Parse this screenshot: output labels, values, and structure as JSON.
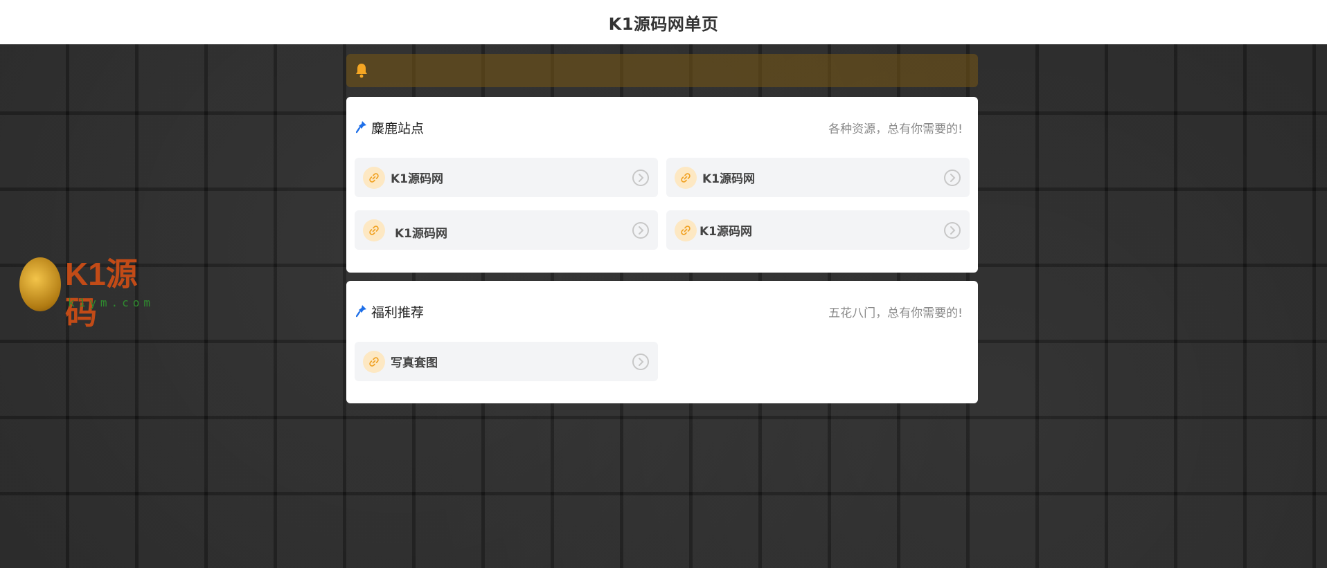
{
  "header": {
    "title": "K1源码网单页"
  },
  "watermark": {
    "brand": "K1源码",
    "domain": "k1ym.com"
  },
  "notice": {
    "icon": "bell-icon",
    "text": ""
  },
  "sections": [
    {
      "title": "麋鹿站点",
      "subtitle": "各种资源，总有你需要的!",
      "items": [
        {
          "label": "K1源码网"
        },
        {
          "label": "K1源码网"
        },
        {
          "label": "K1源码网"
        },
        {
          "label": "K1源码网"
        }
      ]
    },
    {
      "title": "福利推荐",
      "subtitle": "五花八门，总有你需要的!",
      "items": [
        {
          "label": "写真套图"
        }
      ]
    }
  ],
  "colors": {
    "accent_blue": "#1e6fe8",
    "link_orange": "#f0a020",
    "notice_bg": "#78581a"
  }
}
